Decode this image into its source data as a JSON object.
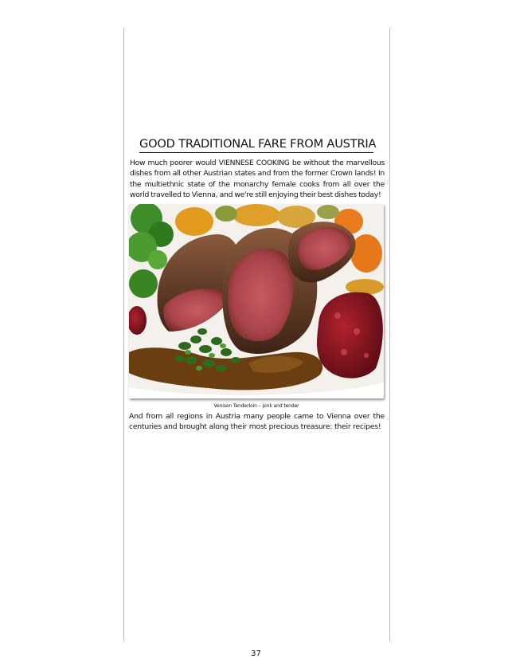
{
  "page": {
    "heading": "GOOD TRADITIONAL FARE FROM AUSTRIA",
    "intro": "How much poorer would VIENNESE COOKING be without the marvellous dishes from all other Austrian states and from the former Crown lands! In the multiethnic state of the monarchy female cooks from all over the world travelled to Vienna, and we're still enjoying their best dishes today!",
    "photo_caption": "Venison Tenderloin – pink and tender",
    "outro": "And from all regions in Austria many people came to Vienna over the centuries and brought along their most precious treasure: their recipes!",
    "page_number": "37"
  }
}
